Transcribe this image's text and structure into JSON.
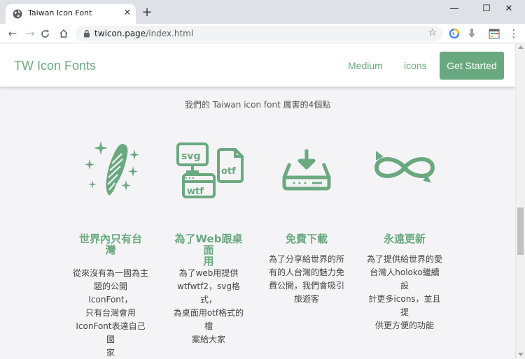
{
  "browser": {
    "tab_title": "Taiwan Icon Font",
    "url_domain": "twicon.page",
    "url_path": "/index.html",
    "window_controls": {
      "minimize": "—",
      "maximize": "☐",
      "close": "✕"
    },
    "new_tab": "+",
    "tab_close": "✕"
  },
  "site": {
    "brand": "TW Icon Fonts",
    "nav": {
      "medium": "Medium",
      "icons": "icons",
      "cta": "Get Started"
    },
    "subtitle": "我們的 Taiwan icon font 厲害的4個點",
    "features": [
      {
        "icon": "taiwan-island-sparkle-icon",
        "title_lines": [
          "世界內只有台",
          "灣"
        ],
        "desc_lines": [
          "從來沒有為一國為主",
          "題的公開IconFont，",
          "只有台灣會用",
          "IconFont表達自己國",
          "家"
        ]
      },
      {
        "icon": "file-formats-icon",
        "title_lines": [
          "為了Web跟桌面",
          "用"
        ],
        "desc_lines": [
          "為了web用提供",
          "wtfwtf2，svg格式，",
          "為桌面用otf格式的檔",
          "案給大家"
        ]
      },
      {
        "icon": "download-tray-icon",
        "title_lines": [
          "免費下載"
        ],
        "desc_lines": [
          "為了分享給世界的所",
          "有的人台灣的魅力免",
          "費公開，我們會吸引",
          "旅遊客"
        ]
      },
      {
        "icon": "infinity-arrows-icon",
        "title_lines": [
          "永遠更新"
        ],
        "desc_lines": [
          "為了提供給世界的愛",
          "台灣人holoko繼續設",
          "計更多icons，並且提",
          "供更方便的功能"
        ]
      }
    ]
  },
  "colors": {
    "accent": "#6aa97f",
    "page_bg": "#f4f4f6",
    "chrome_bg": "#dee1e6"
  }
}
